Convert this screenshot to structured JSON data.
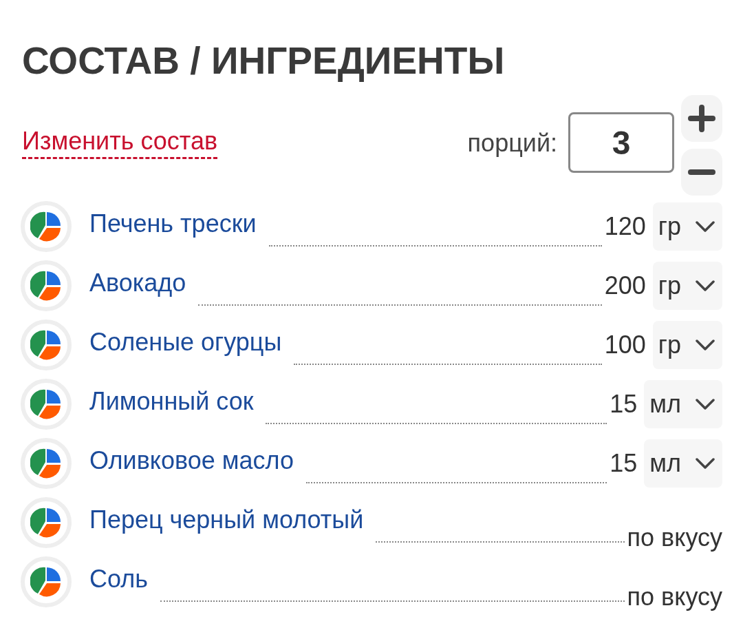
{
  "title": "СОСТАВ / ИНГРЕДИЕНТЫ",
  "edit_link": "Изменить состав",
  "servings": {
    "label": "порций:",
    "value": "3"
  },
  "ingredients": [
    {
      "kind": "measured",
      "name": "Печень трески",
      "amount": "120",
      "unit": "гр"
    },
    {
      "kind": "measured",
      "name": "Авокадо",
      "amount": "200",
      "unit": "гр"
    },
    {
      "kind": "measured",
      "name": "Соленые огурцы",
      "amount": "100",
      "unit": "гр"
    },
    {
      "kind": "measured",
      "name": "Лимонный сок",
      "amount": "15",
      "unit": "мл"
    },
    {
      "kind": "measured",
      "name": "Оливковое масло",
      "amount": "15",
      "unit": "мл"
    },
    {
      "kind": "to_taste",
      "name": "Перец черный молотый",
      "amount": "по вкусу"
    },
    {
      "kind": "to_taste",
      "name": "Соль",
      "amount": "по вкусу"
    }
  ]
}
